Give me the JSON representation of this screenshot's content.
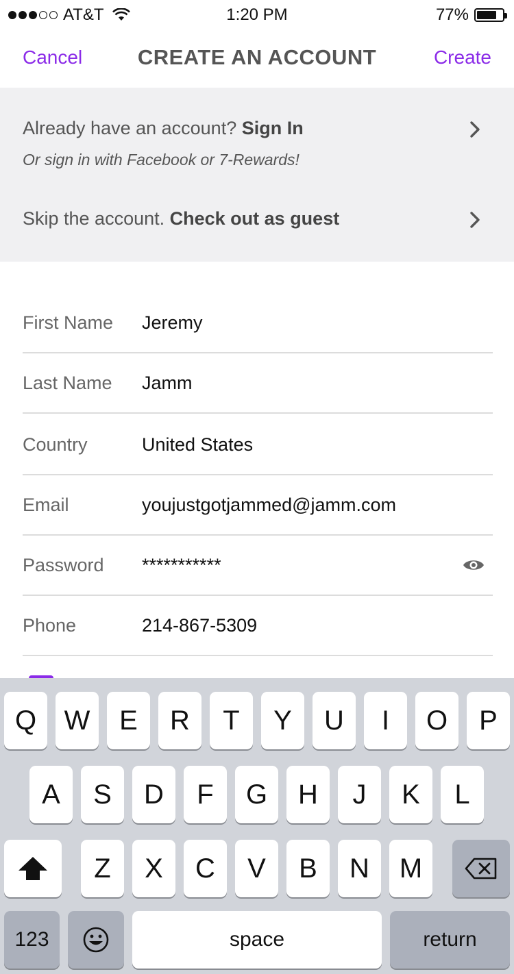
{
  "status_bar": {
    "carrier": "AT&T",
    "time": "1:20 PM",
    "battery_percent": "77%",
    "battery_level": 0.77,
    "signal_bars_filled": 3,
    "signal_bars_total": 5
  },
  "nav": {
    "cancel_label": "Cancel",
    "title": "CREATE AN ACCOUNT",
    "create_label": "Create"
  },
  "options": {
    "sign_in_prefix": "Already have an account? ",
    "sign_in_bold": "Sign In",
    "sign_in_sub": "Or sign in with Facebook or 7-Rewards!",
    "guest_prefix": "Skip the account. ",
    "guest_bold": "Check out as guest"
  },
  "form": {
    "fields": [
      {
        "label": "First Name",
        "value": "Jeremy"
      },
      {
        "label": "Last Name",
        "value": "Jamm"
      },
      {
        "label": "Country",
        "value": "United States"
      },
      {
        "label": "Email",
        "value": "youjustgotjammed@jamm.com"
      },
      {
        "label": "Password",
        "value": "***********"
      },
      {
        "label": "Phone",
        "value": "214-867-5309"
      }
    ]
  },
  "keyboard": {
    "row1": [
      "Q",
      "W",
      "E",
      "R",
      "T",
      "Y",
      "U",
      "I",
      "O",
      "P"
    ],
    "row2": [
      "A",
      "S",
      "D",
      "F",
      "G",
      "H",
      "J",
      "K",
      "L"
    ],
    "row3": [
      "Z",
      "X",
      "C",
      "V",
      "B",
      "N",
      "M"
    ],
    "numbers_label": "123",
    "space_label": "space",
    "return_label": "return"
  },
  "colors": {
    "accent": "#8b2be8",
    "panel_background": "#f0f0f2",
    "keyboard_background": "#d1d4da"
  },
  "icons": {
    "wifi": "wifi-icon",
    "battery": "battery-icon",
    "chevron": "chevron-right-icon",
    "eye": "eye-icon",
    "shift": "shift-icon",
    "delete": "delete-icon",
    "emoji": "emoji-icon"
  }
}
